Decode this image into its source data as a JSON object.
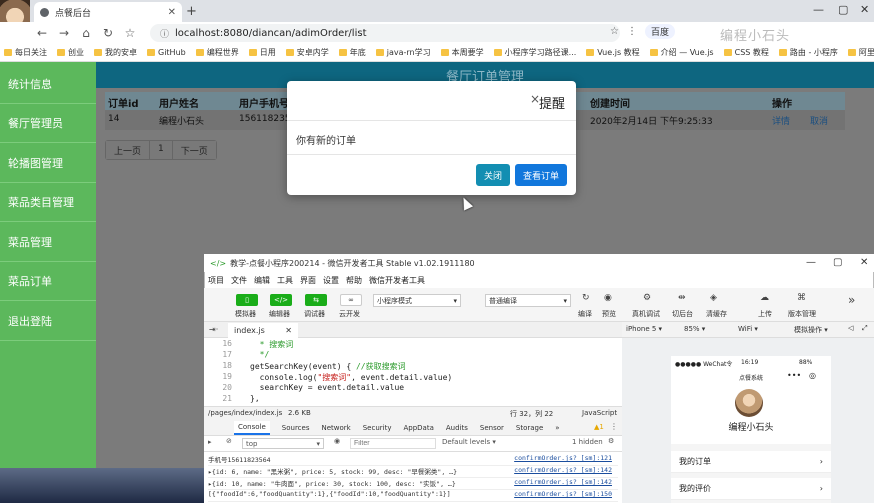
{
  "browser": {
    "tab_title": "点餐后台",
    "url": "localhost:8080/diancan/adimOrder/list",
    "search_engine": "百度",
    "ext_watermark": "编程小石头",
    "bookmarks": [
      "每日关注",
      "创业",
      "我的安卓",
      "GitHub",
      "编程世界",
      "日用",
      "安卓内学",
      "年底",
      "java-rn学习",
      "本周要学",
      "小程序学习路径课...",
      "Vue.js 教程",
      "介绍 — Vue.js",
      "CSS 教程",
      "路由 - 小程序",
      "阿里云推荐有礼活动"
    ]
  },
  "sidebar": {
    "items": [
      "统计信息",
      "餐厅管理员",
      "轮播图管理",
      "菜品类目管理",
      "菜品管理",
      "菜品订单",
      "退出登陆"
    ]
  },
  "page": {
    "title": "餐厅订单管理",
    "columns": {
      "order_id": "订单id",
      "user_name": "用户姓名",
      "user_phone": "用户手机号",
      "created": "创建时间",
      "actions": "操作"
    },
    "rows": [
      {
        "order_id": "14",
        "user_name": "编程小石头",
        "user_phone": "15611823564",
        "created": "2020年2月14日 下午9:25:33",
        "detail": "详情",
        "cancel": "取消"
      }
    ],
    "pager": [
      "上一页",
      "1",
      "下一页"
    ]
  },
  "modal": {
    "title": "提醒",
    "close_x": "×",
    "message": "你有新的订单",
    "close_button": "关闭",
    "view_button": "查看订单"
  },
  "devtools": {
    "title": "教学-点餐小程序200214 - 微信开发者工具 Stable v1.02.1911180",
    "menu": [
      "项目",
      "文件",
      "编辑",
      "工具",
      "界面",
      "设置",
      "帮助",
      "微信开发者工具"
    ],
    "toolbar_left": [
      "模拟器",
      "编辑器",
      "调试器",
      "云开发"
    ],
    "mode_select": "小程序模式",
    "compile_select": "普通编译",
    "toolbar_right": [
      "编译",
      "预览",
      "真机调试",
      "切后台",
      "清缓存",
      "上传",
      "版本管理"
    ],
    "file_tab": "index.js",
    "code": [
      {
        "n": "16",
        "t": "  * 搜索词"
      },
      {
        "n": "17",
        "t": "  */"
      },
      {
        "n": "18",
        "pre": "getSearchKey(event) { ",
        "comment": "//获取搜索词"
      },
      {
        "n": "19",
        "pre": "  console.log(",
        "str": "\"搜索词\"",
        "post": ", event.detail.value)"
      },
      {
        "n": "20",
        "t": "  searchKey = event.detail.value"
      },
      {
        "n": "21",
        "t": "},"
      }
    ],
    "status_path": "/pages/index/index.js",
    "status_size": "2.6 KB",
    "status_pos": "行 32，列 22",
    "status_lang": "JavaScript",
    "console_tabs": [
      "Console",
      "Sources",
      "Network",
      "Security",
      "AppData",
      "Audits",
      "Sensor",
      "Storage",
      "»"
    ],
    "warn_count": "1",
    "context": "top",
    "filter_placeholder": "Filter",
    "levels": "Default levels ▾",
    "hidden": "1 hidden",
    "console_lines": [
      {
        "text": "手机号15611823564",
        "src": "confirmOrder.js? [sm]:121"
      },
      {
        "text": "▸{id: 6, name: \"黑米粥\", price: 5, stock: 99, desc: \"早餐粥类\", …}",
        "src": "confirmOrder.js? [sm]:142"
      },
      {
        "text": "▸{id: 10, name: \"牛肉面\", price: 30, stock: 100, desc: \"实饭\", …}",
        "src": "confirmOrder.js? [sm]:142"
      },
      {
        "text": "[{\"foodId\":6,\"foodQuantity\":1},{\"foodId\":10,\"foodQuantity\":1}]",
        "src": "confirmOrder.js? [sm]:150"
      }
    ],
    "sim_device": "iPhone 5",
    "sim_zoom": "85%",
    "sim_net": "WiFi",
    "sim_op": "模拟操作",
    "phone": {
      "carrier": "●●●●● WeChat令",
      "time": "16:19",
      "battery": "88%",
      "nav_title": "点餐系统",
      "user_name": "编程小石头",
      "menu": [
        "我的订单",
        "我的评价"
      ]
    }
  }
}
